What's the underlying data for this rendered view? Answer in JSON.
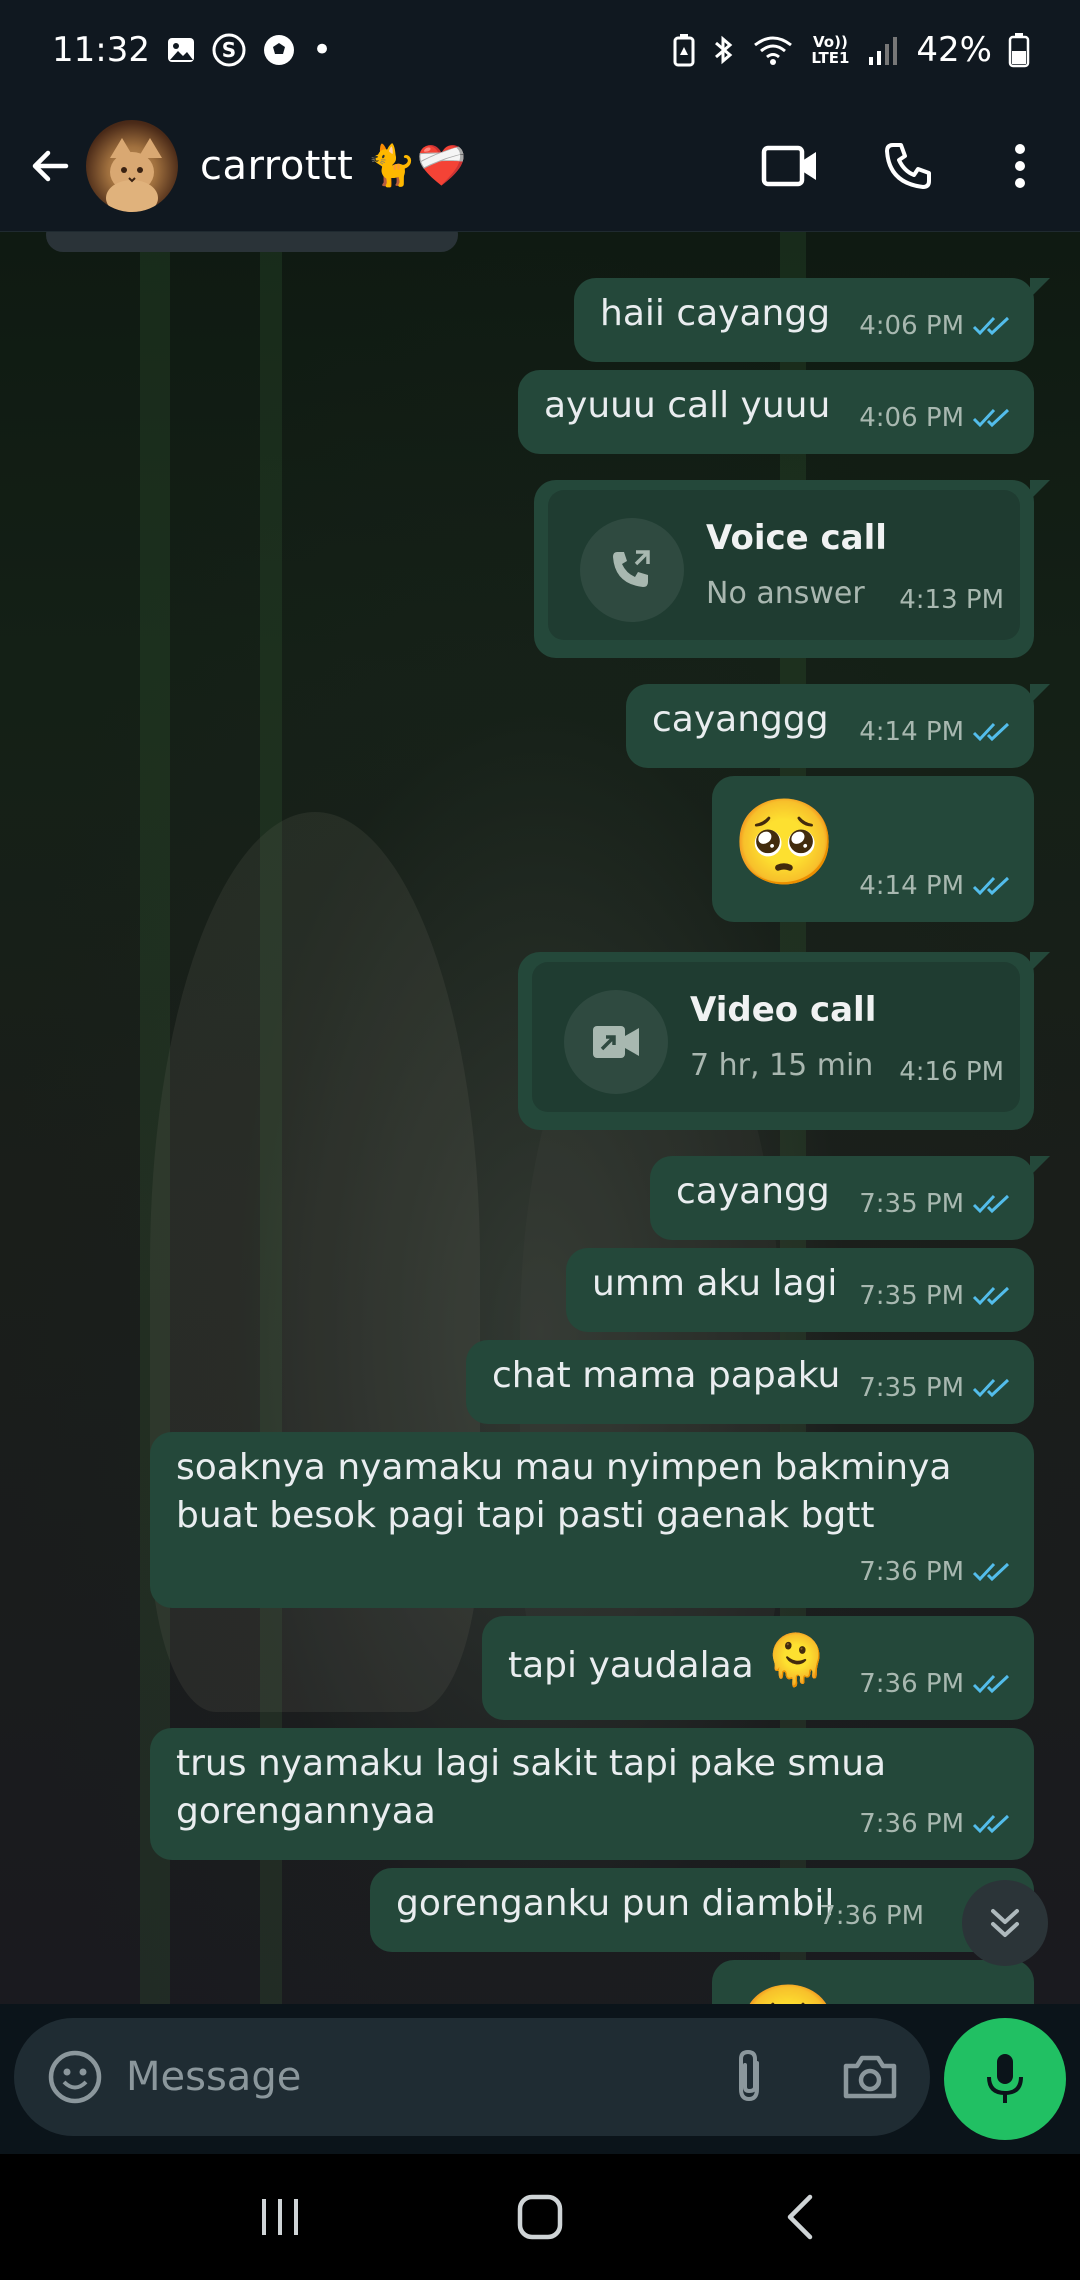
{
  "status_bar": {
    "time": "11:32",
    "dot": "•",
    "volte": "Vo)) LTE1",
    "battery": "42%",
    "left_icons": [
      "gallery-icon",
      "s-app-icon",
      "soccer-ball-icon"
    ],
    "right_icons": [
      "battery-saver-icon",
      "bluetooth-icon",
      "wifi-icon",
      "signal-icon",
      "battery-icon"
    ]
  },
  "header": {
    "contact_name": "carrottt 🐈❤️‍🩹",
    "actions": [
      "back-arrow-icon",
      "video-call-icon",
      "phone-icon",
      "more-vert-icon"
    ]
  },
  "messages": [
    {
      "text": "haii cayangg",
      "time": "4:06 PM"
    },
    {
      "text": "ayuuu call yuuu",
      "time": "4:06 PM"
    },
    {
      "call_type": "Voice call",
      "call_status": "No answer",
      "time": "4:13 PM"
    },
    {
      "text": "cayanggg",
      "time": "4:14 PM"
    },
    {
      "text": "🥺",
      "time": "4:14 PM"
    },
    {
      "call_type": "Video call",
      "call_status": "7 hr, 15 min",
      "time": "4:16 PM"
    },
    {
      "text": "cayangg",
      "time": "7:35 PM"
    },
    {
      "text": "umm aku lagi",
      "time": "7:35 PM"
    },
    {
      "text": "chat mama papaku",
      "time": "7:35 PM"
    },
    {
      "text": "soaknya nyamaku mau nyimpen bakminya buat besok pagi tapi pasti gaenak bgtt",
      "time": "7:36 PM"
    },
    {
      "text": "tapi yaudalaa",
      "emoji": "🫠",
      "time": "7:36 PM"
    },
    {
      "text": "trus nyamaku lagi sakit tapi pake smua gorengannyaa",
      "time": "7:36 PM"
    },
    {
      "text": "gorenganku pun diambil",
      "time": "7:36 PM"
    },
    {
      "text": "🥺"
    }
  ],
  "composer": {
    "placeholder": "Message"
  },
  "colors": {
    "outgoing_bubble": "#24483a",
    "read_ticks": "#53bdeb",
    "mic_button": "#21c063",
    "header_bg": "#101820"
  }
}
